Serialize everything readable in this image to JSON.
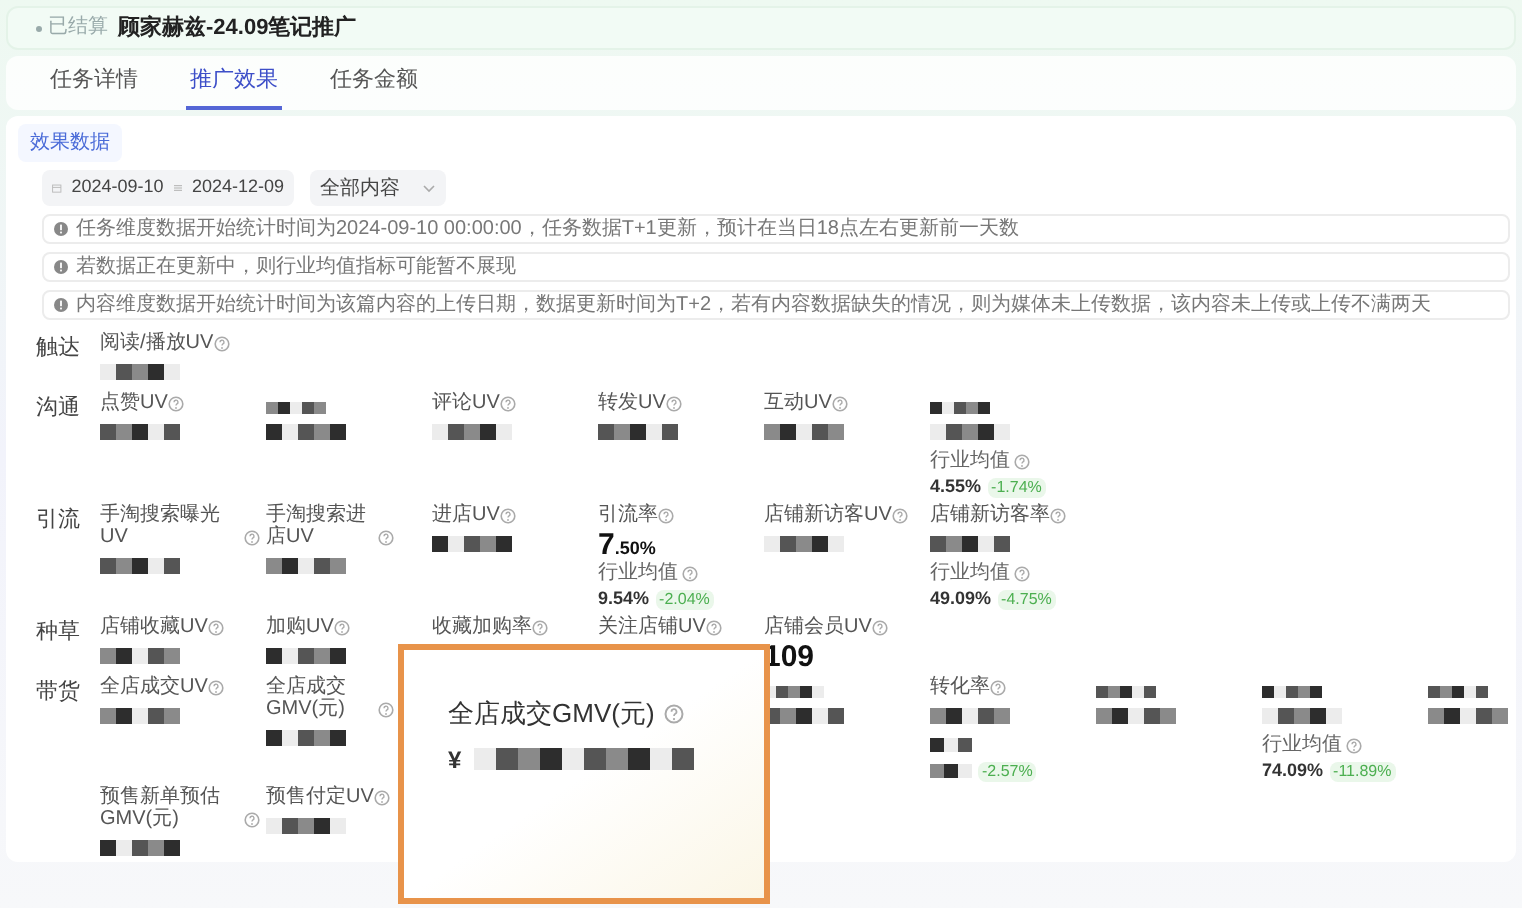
{
  "header": {
    "status": "已结算",
    "title": "顾家赫兹-24.09笔记推广"
  },
  "tabs": [
    {
      "label": "任务详情",
      "selected": false
    },
    {
      "label": "推广效果",
      "selected": true
    },
    {
      "label": "任务金额",
      "selected": false
    }
  ],
  "section_tab": "效果数据",
  "filters": {
    "start_date": "2024-09-10",
    "end_date": "2024-12-09",
    "content_type": "全部内容"
  },
  "notices": [
    "任务维度数据开始统计时间为2024-09-10 00:00:00，任务数据T+1更新，预计在当日18点左右更新前一天数",
    "若数据正在更新中，则行业均值指标可能暂不展现",
    "内容维度数据开始统计时间为该篇内容的上传日期，数据更新时间为T+2，若有内容数据缺失的情况，则为媒体未上传数据，该内容未上传或上传不满两天"
  ],
  "groups": [
    {
      "label": "触达",
      "rows": [
        [
          {
            "kind": "metric",
            "label": "阅读/播放UV",
            "value": {
              "kind": "pixelated"
            }
          }
        ]
      ]
    },
    {
      "label": "沟通",
      "rows": [
        [
          {
            "kind": "metric",
            "label": "点赞UV",
            "value": {
              "kind": "pixelated"
            }
          },
          {
            "kind": "metric",
            "value": {
              "kind": "pixelated"
            }
          },
          {
            "kind": "metric",
            "label": "评论UV",
            "value": {
              "kind": "pixelated"
            }
          },
          {
            "kind": "metric",
            "label": "转发UV",
            "value": {
              "kind": "pixelated"
            }
          },
          {
            "kind": "metric",
            "label": "互动UV",
            "value": {
              "kind": "pixelated"
            }
          },
          {
            "kind": "metric",
            "value": {
              "kind": "pixelated"
            },
            "benchmark": {
              "label": "行业均值",
              "value": "4.55%",
              "change": "-1.74%"
            }
          }
        ]
      ]
    },
    {
      "label": "引流",
      "rows": [
        [
          {
            "kind": "metric",
            "label": "手淘搜索曝光UV",
            "value": {
              "kind": "pixelated"
            }
          },
          {
            "kind": "metric",
            "label": "手淘搜索进店UV",
            "value": {
              "kind": "pixelated"
            }
          },
          {
            "kind": "metric",
            "label": "进店UV",
            "value": {
              "kind": "pixelated"
            }
          },
          {
            "kind": "metric",
            "label": "引流率",
            "value": {
              "kind": "number",
              "text": "7",
              "suffix": ".50%"
            },
            "benchmark": {
              "label": "行业均值",
              "value": "9.54%",
              "change": "-2.04%"
            }
          },
          {
            "kind": "metric",
            "label": "店铺新访客UV",
            "value": {
              "kind": "pixelated"
            }
          },
          {
            "kind": "metric",
            "label": "店铺新访客率",
            "value": {
              "kind": "pixelated"
            },
            "benchmark": {
              "label": "行业均值",
              "value": "49.09%",
              "change": "-4.75%"
            }
          }
        ]
      ]
    },
    {
      "label": "种草",
      "rows": [
        [
          {
            "kind": "metric",
            "label": "店铺收藏UV",
            "value": {
              "kind": "pixelated"
            }
          },
          {
            "kind": "metric",
            "label": "加购UV",
            "value": {
              "kind": "pixelated"
            }
          },
          {
            "kind": "metric",
            "label": "收藏加购率"
          },
          {
            "kind": "metric",
            "label": "关注店铺UV"
          },
          {
            "kind": "metric",
            "label": "店铺会员UV",
            "value": {
              "kind": "number",
              "text": "109"
            }
          }
        ]
      ],
      "callout": {
        "label": "全店成交GMV(元)",
        "currency": "¥"
      }
    },
    {
      "label": "带货",
      "rows": [
        [
          {
            "kind": "metric",
            "label": "全店成交UV",
            "value": {
              "kind": "pixelated"
            }
          },
          {
            "kind": "metric",
            "label": "全店成交GMV(元)",
            "value": {
              "kind": "pixelated"
            }
          },
          {
            "kind": "covered"
          },
          {
            "kind": "covered"
          },
          {
            "kind": "metric",
            "value": {
              "kind": "pixelated"
            }
          },
          {
            "kind": "metric",
            "label": "转化率",
            "value": {
              "kind": "pixelated"
            },
            "benchmark": {
              "change": "-2.57%"
            }
          },
          {
            "kind": "metric",
            "value": {
              "kind": "pixelated"
            }
          },
          {
            "kind": "metric",
            "value": {
              "kind": "pixelated"
            },
            "benchmark": {
              "label": "行业均值",
              "value": "74.09%",
              "change": "-11.89%"
            }
          },
          {
            "kind": "metric",
            "value": {
              "kind": "pixelated"
            }
          }
        ],
        [
          {
            "kind": "metric",
            "label": "预售新单预估GMV(元)",
            "value": {
              "kind": "pixelated"
            }
          },
          {
            "kind": "metric",
            "label": "预售付定UV",
            "value": {
              "kind": "pixelated"
            }
          }
        ]
      ]
    }
  ]
}
